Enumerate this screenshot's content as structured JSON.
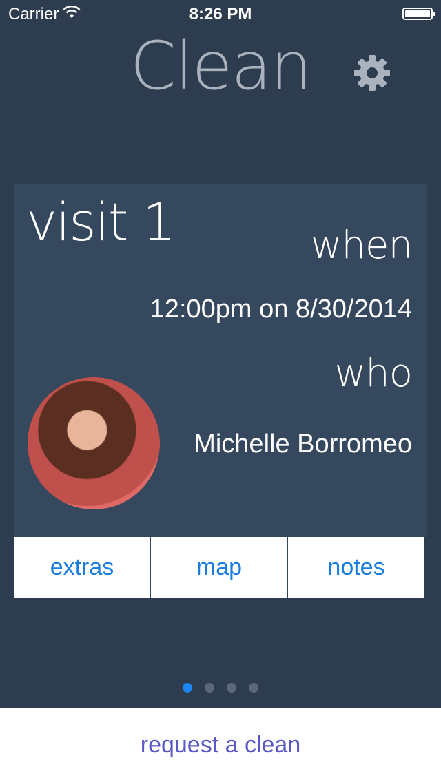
{
  "status_bar": {
    "carrier": "Carrier",
    "time": "8:26 PM"
  },
  "header": {
    "title": "Clean",
    "settings_icon": "gear-icon"
  },
  "visit": {
    "label": "visit 1",
    "when_label": "when",
    "when_value": "12:00pm on 8/30/2014",
    "who_label": "who",
    "who_name": "Michelle Borromeo"
  },
  "card_buttons": [
    {
      "label": "extras"
    },
    {
      "label": "map"
    },
    {
      "label": "notes"
    }
  ],
  "pager": {
    "total": 4,
    "active_index": 0
  },
  "bottom": {
    "request_label": "request a clean"
  },
  "colors": {
    "background": "#2d3c4f",
    "card": "#36485e",
    "link_blue": "#1a7de0",
    "request_purple": "#5a58c6"
  }
}
